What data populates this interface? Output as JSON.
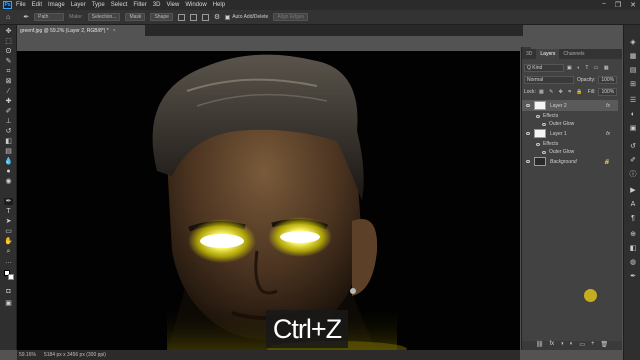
{
  "app": {
    "logo": "Ps"
  },
  "menu": [
    "File",
    "Edit",
    "Image",
    "Layer",
    "Type",
    "Select",
    "Filter",
    "3D",
    "View",
    "Window",
    "Help"
  ],
  "window_controls": [
    "−",
    "❐",
    "✕"
  ],
  "options_bar": {
    "mode": "Path",
    "make_label": "Make:",
    "selection_btn": "Selection...",
    "mask_btn": "Mask",
    "shape_btn": "Shape",
    "auto_add_delete": "Auto Add/Delete",
    "align_edges": "Align Edges"
  },
  "document": {
    "tab_title": "greenf.jpg @ 59.2% (Layer 2, RGB/8*) *",
    "close": "×"
  },
  "caption": "Ctrl+Z",
  "status": {
    "zoom": "59.16%",
    "doc_size": "5184 px x 3456 px (300 ppi)"
  },
  "panel": {
    "tabs": [
      "3D",
      "Layers",
      "Channels"
    ],
    "kind_filter": "Q Kind",
    "blend_mode": "Normal",
    "opacity_label": "Opacity:",
    "opacity_value": "100%",
    "lock_label": "Lock:",
    "fill_label": "Fill:",
    "fill_value": "100%",
    "layers": [
      {
        "name": "Layer 2",
        "fx": "fx",
        "effects": "Effects",
        "effect": "Outer Glow"
      },
      {
        "name": "Layer 1",
        "fx": "fx",
        "effects": "Effects",
        "effect": "Outer Glow"
      },
      {
        "name": "Background"
      }
    ],
    "bottom_icons": [
      "⛓",
      "fx",
      "◑",
      "◐",
      "▭",
      "+",
      "🗑"
    ]
  },
  "colors": {
    "accent": "#31a8ff",
    "glow": "#f4f21a",
    "panel_bg": "#424242",
    "selected_layer": "#5a5a5a"
  }
}
